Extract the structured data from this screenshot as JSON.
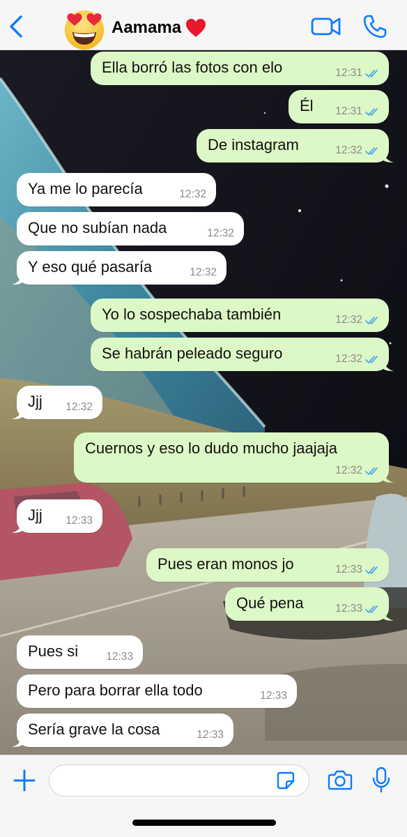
{
  "header": {
    "contact_name": "Aamama",
    "back_icon": "chevron-left-icon",
    "avatar_icon": "heart-eyes-emoji",
    "heart_icon": "red-heart-emoji",
    "video_icon": "video-camera-icon",
    "call_icon": "phone-icon",
    "accent_color": "#0a7cff"
  },
  "messages": [
    {
      "dir": "out",
      "text": "Ella borró las fotos con elo",
      "time": "12:31",
      "status": "read"
    },
    {
      "dir": "out",
      "text": "Él",
      "time": "12:31",
      "status": "read"
    },
    {
      "dir": "out",
      "text": "De instagram",
      "time": "12:32",
      "status": "read"
    },
    {
      "dir": "in",
      "text": "Ya me lo parecía",
      "time": "12:32"
    },
    {
      "dir": "in",
      "text": "Que no subían nada",
      "time": "12:32"
    },
    {
      "dir": "in",
      "text": "Y eso qué pasaría",
      "time": "12:32"
    },
    {
      "dir": "out",
      "text": "Yo lo sospechaba también",
      "time": "12:32",
      "status": "read"
    },
    {
      "dir": "out",
      "text": "Se habrán peleado seguro",
      "time": "12:32",
      "status": "read"
    },
    {
      "dir": "in",
      "text": "Jjj",
      "time": "12:32"
    },
    {
      "dir": "out",
      "text": "Cuernos y eso lo dudo mucho jaajaja",
      "time": "12:32",
      "status": "read"
    },
    {
      "dir": "in",
      "text": "Jjj",
      "time": "12:33"
    },
    {
      "dir": "out",
      "text": "Pues eran monos jo",
      "time": "12:33",
      "status": "read"
    },
    {
      "dir": "out",
      "text": "Qué pena",
      "time": "12:33",
      "status": "read"
    },
    {
      "dir": "in",
      "text": "Pues si",
      "time": "12:33"
    },
    {
      "dir": "in",
      "text": "Pero para borrar ella todo",
      "time": "12:33"
    },
    {
      "dir": "in",
      "text": "Sería grave la cosa",
      "time": "12:33"
    }
  ],
  "colors": {
    "outgoing_bubble": "#dcf8c6",
    "incoming_bubble": "#ffffff",
    "read_ticks": "#4fa9e8"
  },
  "input_bar": {
    "message_value": "",
    "plus_icon": "plus-icon",
    "sticker_icon": "sticker-icon",
    "camera_icon": "camera-icon",
    "mic_icon": "microphone-icon"
  }
}
